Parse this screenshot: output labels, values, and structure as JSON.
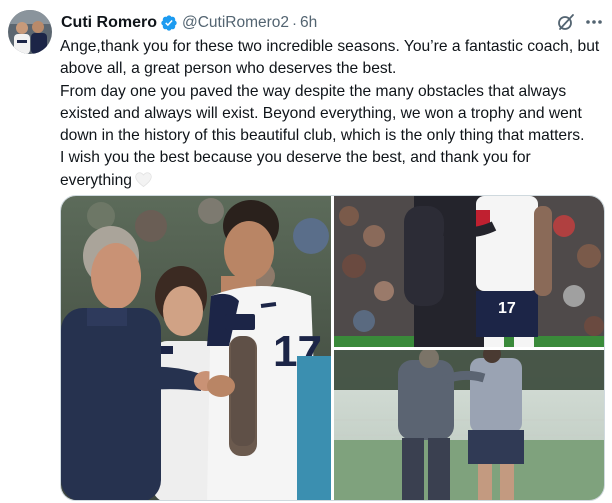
{
  "author": {
    "display_name": "Cuti Romero",
    "handle": "@CutiRomero2",
    "separator": "·",
    "time": "6h",
    "verified": true,
    "verified_color": "#1d9bf0"
  },
  "tweet": {
    "paragraphs": [
      "Ange,thank you for these two incredible seasons. You’re a fantastic coach, but above all, a great person who deserves the best.",
      "From day one you paved the way despite the many obstacles that always existed and always will exist. Beyond everything, we won a trophy and went down in the history of this beautiful club, which is the only thing that matters.",
      "I wish you the best because you deserve the best, and thank you for everything"
    ],
    "emoji": "white-heart"
  },
  "media": {
    "count": 3,
    "images": [
      {
        "name": "photo-postecoglou-romero-handshake"
      },
      {
        "name": "photo-embrace-number-17"
      },
      {
        "name": "photo-training-ground-embrace"
      }
    ],
    "shirt_number": "17"
  },
  "icons": {
    "grok": "grok-icon",
    "more": "more-icon",
    "verified": "verified-badge-icon"
  },
  "colors": {
    "text": "#0f1419",
    "secondary": "#536471",
    "border": "#cfd9de"
  }
}
